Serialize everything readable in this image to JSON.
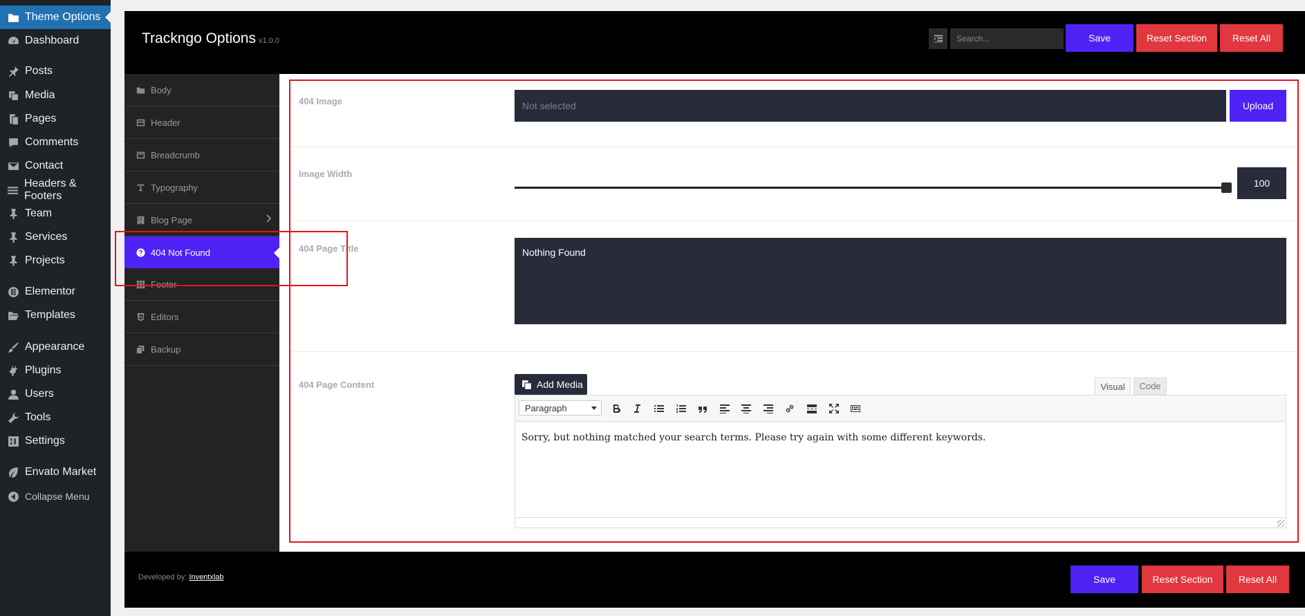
{
  "wp_menu": {
    "items": [
      {
        "label": "Theme Options",
        "icon": "folder-icon"
      },
      {
        "label": "Dashboard",
        "icon": "dashboard-icon"
      },
      {
        "label": "Posts",
        "icon": "pin-icon"
      },
      {
        "label": "Media",
        "icon": "media-icon"
      },
      {
        "label": "Pages",
        "icon": "pages-icon"
      },
      {
        "label": "Comments",
        "icon": "comment-icon"
      },
      {
        "label": "Contact",
        "icon": "mail-icon"
      },
      {
        "label": "Headers & Footers",
        "icon": "menu-icon"
      },
      {
        "label": "Team",
        "icon": "pin-icon"
      },
      {
        "label": "Services",
        "icon": "pin-icon"
      },
      {
        "label": "Projects",
        "icon": "pin-icon"
      },
      {
        "label": "Elementor",
        "icon": "elementor-icon"
      },
      {
        "label": "Templates",
        "icon": "folder-open-icon"
      },
      {
        "label": "Appearance",
        "icon": "brush-icon"
      },
      {
        "label": "Plugins",
        "icon": "plug-icon"
      },
      {
        "label": "Users",
        "icon": "user-icon"
      },
      {
        "label": "Tools",
        "icon": "wrench-icon"
      },
      {
        "label": "Settings",
        "icon": "settings-icon"
      },
      {
        "label": "Envato Market",
        "icon": "leaf-icon"
      },
      {
        "label": "Collapse Menu",
        "icon": "collapse-icon"
      }
    ]
  },
  "header": {
    "title": "Trackngo Options",
    "version": "v1.0.0",
    "search_placeholder": "Search...",
    "save": "Save",
    "reset_section": "Reset Section",
    "reset_all": "Reset All"
  },
  "nav": {
    "items": [
      {
        "label": "Body",
        "icon": "folder-icon"
      },
      {
        "label": "Header",
        "icon": "header-icon"
      },
      {
        "label": "Breadcrumb",
        "icon": "breadcrumb-icon"
      },
      {
        "label": "Typography",
        "icon": "text-icon"
      },
      {
        "label": "Blog Page",
        "icon": "building-icon"
      },
      {
        "label": "404 Not Found",
        "icon": "question-icon"
      },
      {
        "label": "Footer",
        "icon": "grid-icon"
      },
      {
        "label": "Editors",
        "icon": "css-icon"
      },
      {
        "label": "Backup",
        "icon": "copy-icon"
      }
    ]
  },
  "fields": {
    "image": {
      "label": "404 Image",
      "placeholder": "Not selected",
      "upload": "Upload"
    },
    "width": {
      "label": "Image Width",
      "value": "100",
      "fraction": 1.0
    },
    "title": {
      "label": "404 Page Title",
      "value": "Nothing Found"
    },
    "content": {
      "label": "404 Page Content",
      "add_media": "Add Media",
      "tab_visual": "Visual",
      "tab_code": "Code",
      "format": "Paragraph",
      "body": "Sorry, but nothing matched your search terms. Please try again with some different keywords."
    }
  },
  "footer": {
    "developed_by": "Developed by:",
    "developer": "Inventxlab",
    "save": "Save",
    "reset_section": "Reset Section",
    "reset_all": "Reset All"
  },
  "colors": {
    "accent": "#4e22f5",
    "danger": "#e0383e",
    "wp_active": "#2271b1"
  }
}
